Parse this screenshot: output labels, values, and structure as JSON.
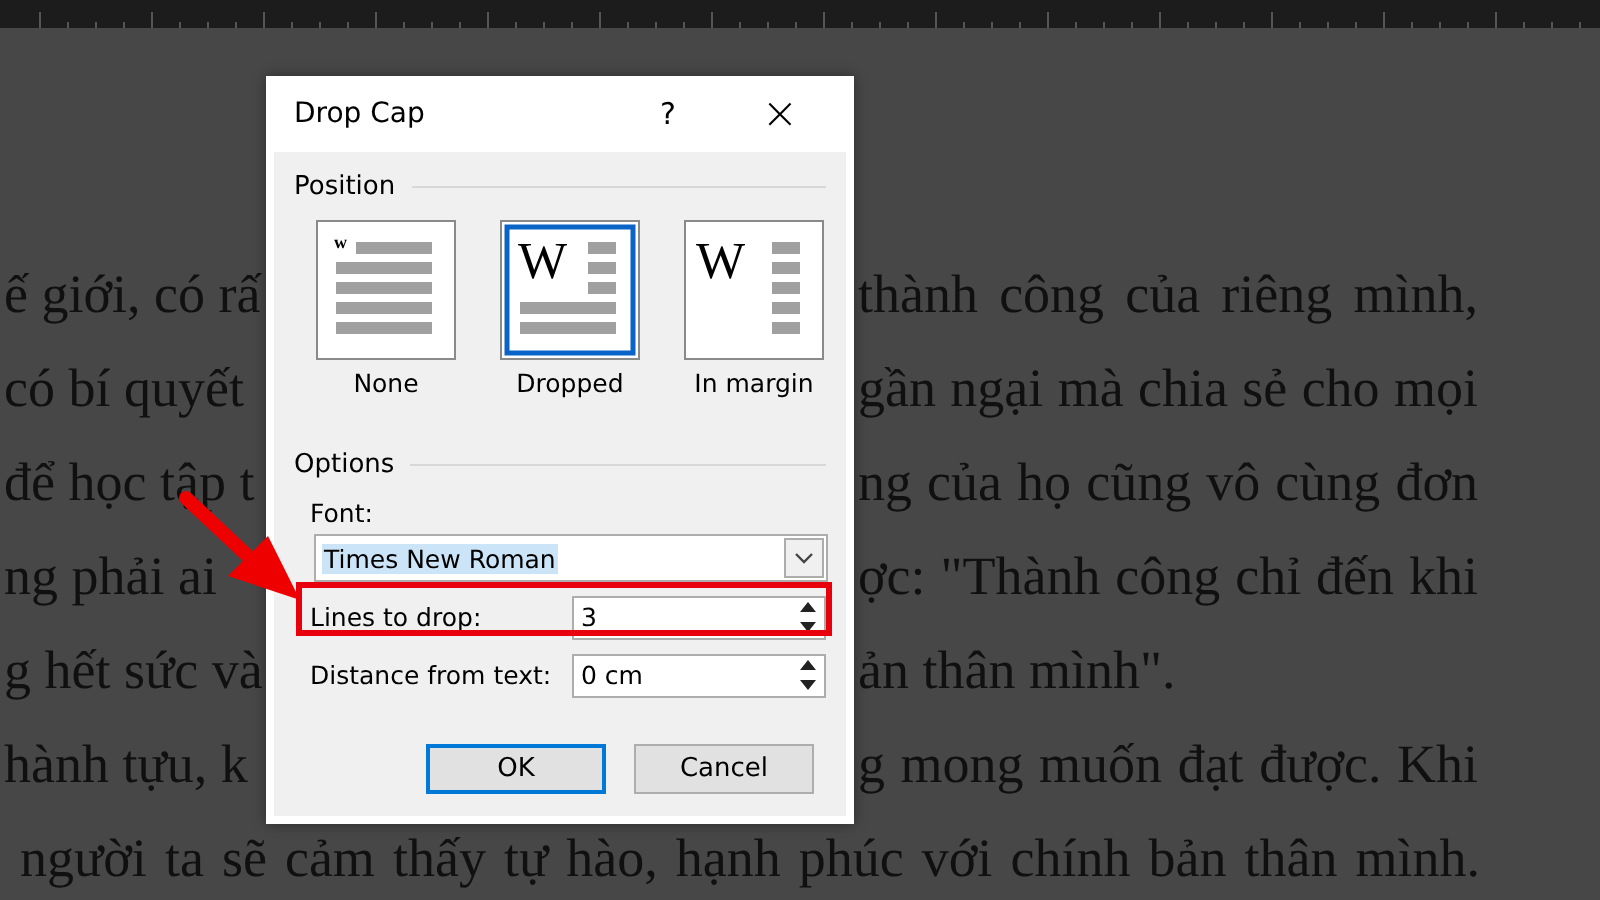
{
  "document": {
    "lines": [
      {
        "kind": "split",
        "left": "ế giới, có rấ",
        "right": "thành công của riêng mình,"
      },
      {
        "kind": "split",
        "left": "có bí quyết",
        "right": "gần ngại mà chia sẻ cho mọi"
      },
      {
        "kind": "split",
        "left": "để học tập t",
        "right": "ng của họ cũng vô cùng đơn"
      },
      {
        "kind": "split",
        "left": "ng phải ai",
        "right": "ợc: \"Thành công chỉ đến khi"
      },
      {
        "kind": "split-end",
        "left": "g hết sức và",
        "right": "ản thân mình\"."
      },
      {
        "kind": "split",
        "left": "hành tựu, k",
        "right": "g mong muốn đạt được. Khi"
      },
      {
        "kind": "full",
        "text": "người ta sẽ cảm thấy tự hào, hạnh phúc với chính bản thân mình."
      }
    ]
  },
  "dialog": {
    "title": "Drop Cap",
    "help": "?",
    "close": "×",
    "position_label": "Position",
    "positions": [
      {
        "kind": "none",
        "label": "None",
        "letter": "w",
        "selected": false
      },
      {
        "kind": "dropped",
        "label": "Dropped",
        "letter": "W",
        "selected": true
      },
      {
        "kind": "margin",
        "label": "In margin",
        "letter": "W",
        "selected": false
      }
    ],
    "options_label": "Options",
    "font_label": "Font:",
    "font_value": "Times New Roman",
    "lines_label": "Lines to drop:",
    "lines_value": "3",
    "distance_label": "Distance from text:",
    "distance_value": "0 cm",
    "buttons": [
      {
        "label": "OK",
        "default": true
      },
      {
        "label": "Cancel",
        "default": false
      }
    ]
  },
  "annotations": {
    "pointer_arrow": true,
    "highlight_frame": true
  }
}
